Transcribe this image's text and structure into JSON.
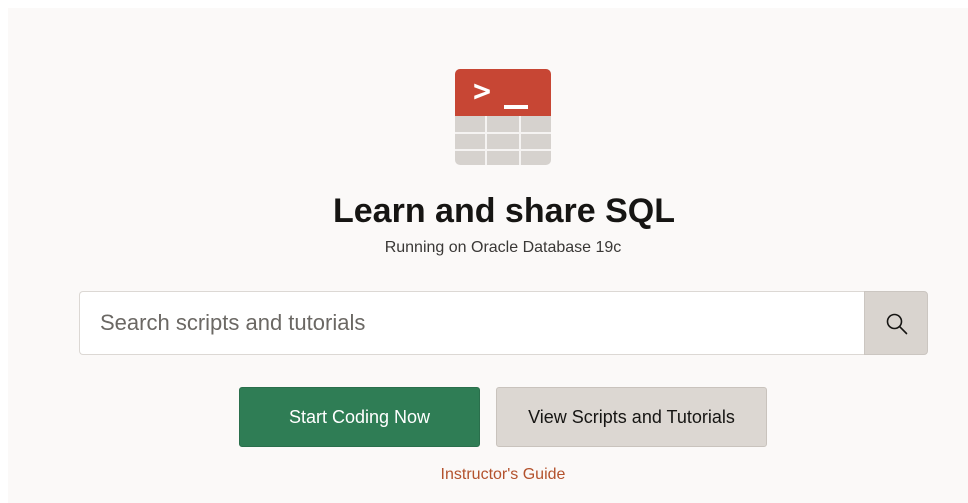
{
  "hero": {
    "logo_icon": "sql-terminal-table-icon",
    "logo_prompt": ">",
    "title": "Learn and share SQL",
    "subtitle": "Running on Oracle Database 19c"
  },
  "search": {
    "placeholder": "Search scripts and tutorials",
    "value": "",
    "button_icon": "search-icon"
  },
  "actions": {
    "primary_label": "Start Coding Now",
    "secondary_label": "View Scripts and Tutorials",
    "guide_link": "Instructor's Guide"
  },
  "colors": {
    "background": "#fbf9f8",
    "logo_red": "#c74634",
    "primary_green": "#2f7d55",
    "secondary_gray": "#dcd7d2",
    "link_orange": "#b3522d"
  }
}
